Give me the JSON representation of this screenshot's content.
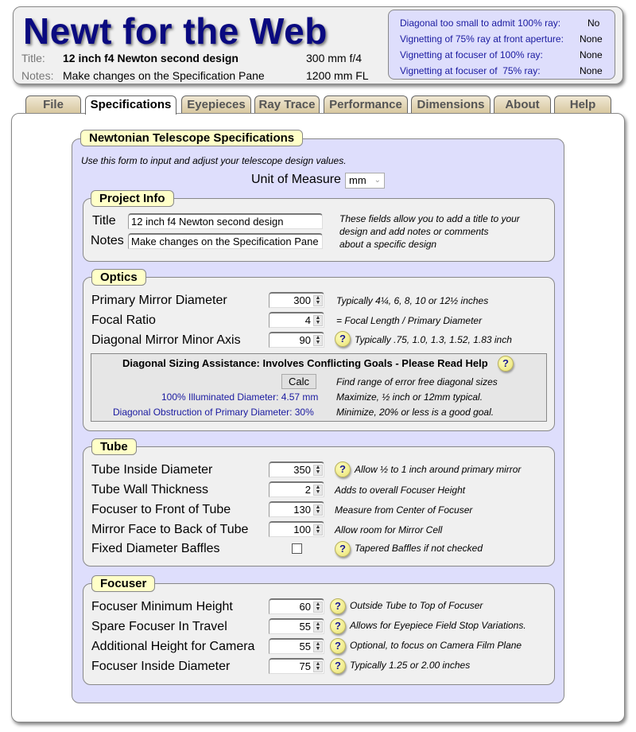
{
  "header": {
    "app_title": "Newt for the Web",
    "title_label": "Title:",
    "title_value": "12 inch f4 Newton second design",
    "aperture_spec": "300 mm f/4",
    "notes_label": "Notes:",
    "notes_value": "Make changes on the Specification Pane",
    "focal_length_spec": "1200 mm FL"
  },
  "status": [
    {
      "label": "Diagonal too small to admit 100% ray:",
      "value": "No"
    },
    {
      "label": "Vignetting of 75% ray at front aperture:",
      "value": "None"
    },
    {
      "label": "Vignetting at focuser of 100% ray:",
      "value": "None"
    },
    {
      "label": "Vignetting at focuser of  75% ray:",
      "value": "None"
    }
  ],
  "tabs": [
    {
      "label": "File",
      "active": false
    },
    {
      "label": "Specifications",
      "active": true
    },
    {
      "label": "Eyepieces",
      "active": false
    },
    {
      "label": "Ray Trace",
      "active": false
    },
    {
      "label": "Performance",
      "active": false
    },
    {
      "label": "Dimensions",
      "active": false
    },
    {
      "label": "About",
      "active": false
    },
    {
      "label": "Help",
      "active": false
    }
  ],
  "spec": {
    "legend": "Newtonian Telescope Specifications",
    "intro": "Use this form to input and adjust your telescope design values.",
    "unit_label": "Unit of Measure",
    "unit_value": "mm"
  },
  "project": {
    "legend": "Project Info",
    "title_label": "Title",
    "title_value": "12 inch f4 Newton second design",
    "notes_label": "Notes",
    "notes_value": "Make changes on the Specification Pane",
    "hint_lines": [
      "These fields allow you to add a title to your",
      "design and add notes or comments",
      "about a specific design"
    ]
  },
  "optics": {
    "legend": "Optics",
    "rows": [
      {
        "label": "Primary Mirror Diameter",
        "value": "300",
        "hint": "Typically 4¼, 6, 8, 10 or 12½ inches",
        "help": false
      },
      {
        "label": "Focal Ratio",
        "value": "4",
        "hint": "= Focal Length / Primary Diameter",
        "help": false
      },
      {
        "label": "Diagonal Mirror Minor Axis",
        "value": "90",
        "hint": "Typically .75, 1.0, 1.3, 1.52, 1.83 inch",
        "help": true
      }
    ],
    "diag": {
      "title": "Diagonal Sizing Assistance: Involves Conflicting Goals - Please Read Help",
      "calc_label": "Calc",
      "calc_hint": "Find range of error free diagonal sizes",
      "illum_label": "100% Illuminated Diameter: 4.57 mm",
      "illum_hint": "Maximize, ½ inch or 12mm typical.",
      "obstr_label": "Diagonal Obstruction of Primary Diameter: 30%",
      "obstr_hint": "Minimize, 20% or less is a good goal."
    }
  },
  "tube": {
    "legend": "Tube",
    "rows": [
      {
        "label": "Tube Inside Diameter",
        "value": "350",
        "hint": "Allow ½ to 1 inch around primary mirror",
        "help": true
      },
      {
        "label": "Tube Wall Thickness",
        "value": "2",
        "hint": "Adds to overall Focuser Height",
        "help": false
      },
      {
        "label": "Focuser to Front of Tube",
        "value": "130",
        "hint": "Measure from Center of Focuser",
        "help": false
      },
      {
        "label": "Mirror Face to Back of Tube",
        "value": "100",
        "hint": "Allow room for Mirror Cell",
        "help": false
      }
    ],
    "baffles_label": "Fixed Diameter Baffles",
    "baffles_checked": false,
    "baffles_hint": "Tapered Baffles if not checked"
  },
  "focuser": {
    "legend": "Focuser",
    "rows": [
      {
        "label": "Focuser Minimum Height",
        "value": "60",
        "hint": "Outside Tube to Top of Focuser",
        "help": true
      },
      {
        "label": "Spare Focuser In Travel",
        "value": "55",
        "hint": "Allows for Eyepiece Field Stop Variations.",
        "help": true
      },
      {
        "label": "Additional Height for Camera",
        "value": "55",
        "hint": "Optional, to focus on Camera Film Plane",
        "help": true
      },
      {
        "label": "Focuser Inside Diameter",
        "value": "75",
        "hint": "Typically 1.25 or 2.00 inches",
        "help": true
      }
    ]
  },
  "icons": {
    "help": "?",
    "spin": "▲▼",
    "chevron": "⌄"
  }
}
